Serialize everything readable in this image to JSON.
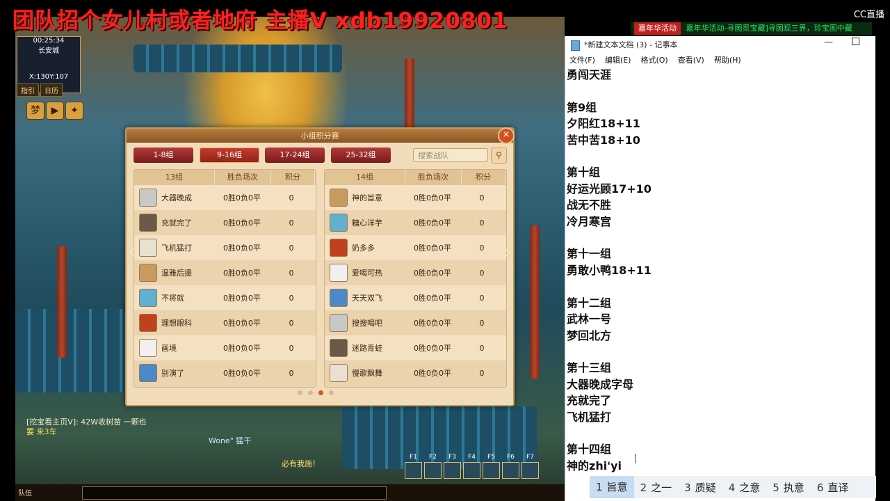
{
  "stream": {
    "banner": "团队招个女儿村或者地府 主播V xdb19920801",
    "platform": "CC直播",
    "ticker_tag": "嘉年华活动",
    "ticker_text": "嘉年华活动-寻图觅宝藏]寻图现三界，珍宝图中藏"
  },
  "game": {
    "minimap": {
      "time": "00:25:34",
      "location": "长安城",
      "coords": "X:130Y:107"
    },
    "minimap_buttons": [
      "指引",
      "日历"
    ],
    "chat": {
      "line1": "[挖宝看主页V]: 42W收树苗  一颗也",
      "line2": "要    来3车"
    },
    "floating_name": "Wone\" 猛干",
    "floating_text": "必有我施！",
    "hotkeys": [
      "F1",
      "F2",
      "F3",
      "F4",
      "F5",
      "F6",
      "F7"
    ],
    "chat_channel": "队伍"
  },
  "dialog": {
    "title": "小组积分赛",
    "tabs": [
      "1-8组",
      "9-16组",
      "17-24组",
      "25-32组"
    ],
    "active_tab": "9-16组",
    "search_placeholder": "搜索战队",
    "columns": {
      "record": "胜负场次",
      "points": "积分"
    },
    "groups": [
      {
        "name": "13组",
        "teams": [
          {
            "name": "大器晚成",
            "record": "0胜0负0平",
            "points": "0"
          },
          {
            "name": "充就完了",
            "record": "0胜0负0平",
            "points": "0"
          },
          {
            "name": "飞机猛打",
            "record": "0胜0负0平",
            "points": "0"
          },
          {
            "name": "温雅后援",
            "record": "0胜0负0平",
            "points": "0"
          },
          {
            "name": "不将就",
            "record": "0胜0负0平",
            "points": "0"
          },
          {
            "name": "理想眼科",
            "record": "0胜0负0平",
            "points": "0"
          },
          {
            "name": "画境",
            "record": "0胜0负0平",
            "points": "0"
          },
          {
            "name": "别演了",
            "record": "0胜0负0平",
            "points": "0"
          }
        ]
      },
      {
        "name": "14组",
        "teams": [
          {
            "name": "神的旨意",
            "record": "0胜0负0平",
            "points": "0"
          },
          {
            "name": "糖心洋芋",
            "record": "0胜0负0平",
            "points": "0"
          },
          {
            "name": "奶多多",
            "record": "0胜0负0平",
            "points": "0"
          },
          {
            "name": "爱喝可热",
            "record": "0胜0负0平",
            "points": "0"
          },
          {
            "name": "天天双飞",
            "record": "0胜0负0平",
            "points": "0"
          },
          {
            "name": "搜搜喝吧",
            "record": "0胜0负0平",
            "points": "0"
          },
          {
            "name": "迷路青蛙",
            "record": "0胜0负0平",
            "points": "0"
          },
          {
            "name": "慢歌飘舞",
            "record": "0胜0负0平",
            "points": "0"
          }
        ]
      }
    ],
    "page_count": 4,
    "current_page": 3
  },
  "notepad": {
    "title": "*新建文本文档 (3) - 记事本",
    "menu": [
      "文件(F)",
      "编辑(E)",
      "格式(O)",
      "查看(V)",
      "帮助(H)"
    ],
    "text": "勇闯天涯\n\n第9组\n夕阳红18+11\n苦中苦18+10\n\n第十组\n好运光顾17+10\n战无不胜\n冷月寒宫\n\n第十一组\n勇敢小鸭18+11\n\n第十二组\n武林一号\n梦回北方\n\n第十三组\n大器晚成字母\n充就完了\n飞机猛打\n\n第十四组\n神的zhi'yi"
  },
  "ime": {
    "candidates": [
      {
        "num": "1",
        "text": "旨意"
      },
      {
        "num": "2",
        "text": "之一"
      },
      {
        "num": "3",
        "text": "质疑"
      },
      {
        "num": "4",
        "text": "之意"
      },
      {
        "num": "5",
        "text": "执意"
      },
      {
        "num": "6",
        "text": "直译"
      }
    ]
  }
}
